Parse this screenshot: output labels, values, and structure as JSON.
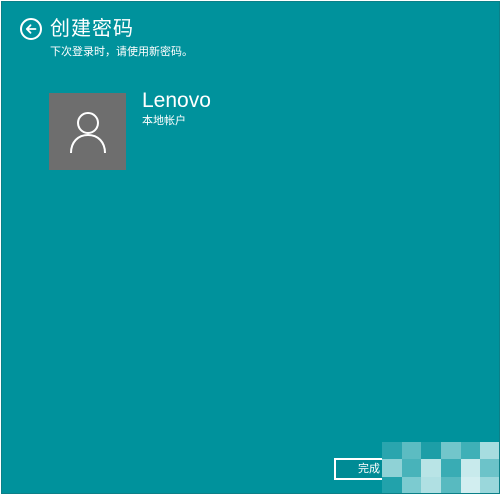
{
  "header": {
    "back_icon": "back-arrow-circle-icon",
    "title": "创建密码",
    "subtitle": "下次登录时，请使用新密码。"
  },
  "account": {
    "avatar_icon": "user-silhouette-icon",
    "name": "Lenovo",
    "type": "本地帐户"
  },
  "actions": {
    "finish_label": "完成"
  },
  "colors": {
    "background": "#00929c",
    "avatar_tile": "#6e6e6e",
    "text": "#ffffff"
  }
}
